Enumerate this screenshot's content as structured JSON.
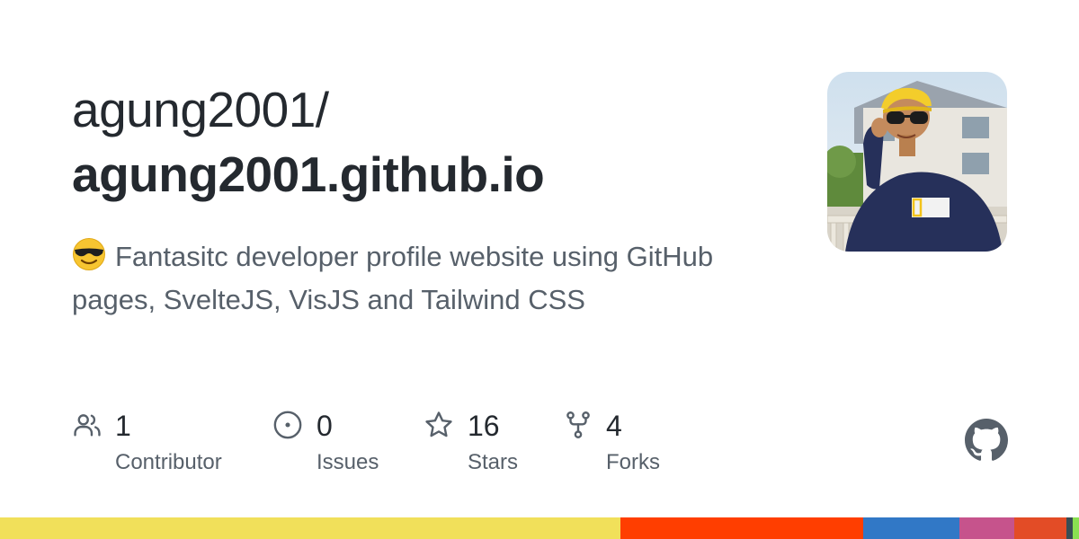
{
  "repo": {
    "owner": "agung2001/",
    "name": "agung2001.github.io",
    "description": "Fantasitc developer profile website using GitHub pages, SvelteJS, VisJS and Tailwind CSS",
    "description_emoji": "smiling-face-with-sunglasses-emoji"
  },
  "avatar": {
    "icon": "user-avatar-photo"
  },
  "stats": [
    {
      "icon": "people-icon",
      "value": "1",
      "label": "Contributor"
    },
    {
      "icon": "issue-opened-icon",
      "value": "0",
      "label": "Issues"
    },
    {
      "icon": "star-icon",
      "value": "16",
      "label": "Stars"
    },
    {
      "icon": "repo-forked-icon",
      "value": "4",
      "label": "Forks"
    }
  ],
  "brand": {
    "icon": "github-mark-icon"
  },
  "colors": {
    "title": "#24292f",
    "muted": "#57606a",
    "icon": "#57606a"
  },
  "language_bar": [
    {
      "color": "#f1e05a",
      "share": 57.5
    },
    {
      "color": "#ff3e00",
      "share": 22.5
    },
    {
      "color": "#3178c6",
      "share": 8.9
    },
    {
      "color": "#c6538c",
      "share": 5.1
    },
    {
      "color": "#e34c26",
      "share": 4.8
    },
    {
      "color": "#384d54",
      "share": 0.6
    },
    {
      "color": "#89e051",
      "share": 0.6
    }
  ]
}
